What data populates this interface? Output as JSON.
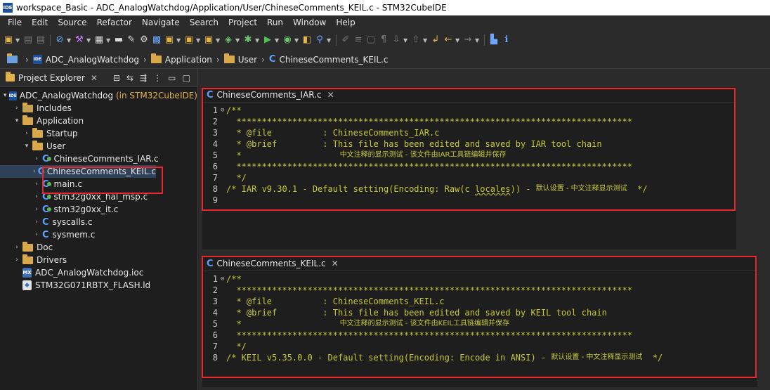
{
  "window": {
    "title": "workspace_Basic - ADC_AnalogWatchdog/Application/User/ChineseComments_KEIL.c - STM32CubeIDE",
    "app_icon_label": "IDE"
  },
  "menu": [
    "File",
    "Edit",
    "Source",
    "Refactor",
    "Navigate",
    "Search",
    "Project",
    "Run",
    "Window",
    "Help"
  ],
  "breadcrumb": [
    "ADC_AnalogWatchdog",
    "Application",
    "User",
    "ChineseComments_KEIL.c"
  ],
  "explorer": {
    "tab_label": "Project Explorer",
    "project": {
      "name": "ADC_AnalogWatchdog",
      "suffix": "(in STM32CubeIDE)"
    },
    "items": [
      {
        "label": "Includes"
      },
      {
        "label": "Application"
      },
      {
        "label": "Startup"
      },
      {
        "label": "User"
      },
      {
        "label": "ChineseComments_IAR.c"
      },
      {
        "label": "ChineseComments_KEIL.c"
      },
      {
        "label": "main.c"
      },
      {
        "label": "stm32g0xx_hal_msp.c"
      },
      {
        "label": "stm32g0xx_it.c"
      },
      {
        "label": "syscalls.c"
      },
      {
        "label": "sysmem.c"
      },
      {
        "label": "Doc"
      },
      {
        "label": "Drivers"
      },
      {
        "label": "ADC_AnalogWatchdog.ioc"
      },
      {
        "label": "STM32G071RBTX_FLASH.ld"
      }
    ]
  },
  "editor_iar": {
    "tab_label": "ChineseComments_IAR.c",
    "lines": [
      {
        "n": "1",
        "text": "/**"
      },
      {
        "n": "2",
        "text": "  ******************************************************************************"
      },
      {
        "n": "3",
        "text": "  * @file          : ChineseComments_IAR.c"
      },
      {
        "n": "4",
        "text": "  * @brief         : This file has been edited and saved by IAR tool chain"
      },
      {
        "n": "5",
        "text": "  *"
      },
      {
        "n": "6",
        "text": "  ******************************************************************************"
      },
      {
        "n": "7",
        "text": "  */"
      },
      {
        "n": "8",
        "text": "/* IAR v9.30.1 - Default setting(Encoding: Raw(c "
      },
      {
        "n": "9",
        "text": ""
      }
    ],
    "line5_cjk": "中文注释的显示测试 - 该文件由IAR工具链编辑并保存",
    "line8_squiggle": "locales",
    "line8_tail": ")) - ",
    "line8_cjk": "默认设置 - 中文注释显示测试",
    "line8_end": "  */"
  },
  "editor_keil": {
    "tab_label": "ChineseComments_KEIL.c",
    "lines": [
      {
        "n": "1",
        "text": "/**"
      },
      {
        "n": "2",
        "text": "  ******************************************************************************"
      },
      {
        "n": "3",
        "text": "  * @file          : ChineseComments_KEIL.c"
      },
      {
        "n": "4",
        "text": "  * @brief         : This file has been edited and saved by KEIL tool chain"
      },
      {
        "n": "5",
        "text": "  *"
      },
      {
        "n": "6",
        "text": "  ******************************************************************************"
      },
      {
        "n": "7",
        "text": "  */"
      },
      {
        "n": "8",
        "text": "/* KEIL v5.35.0.0 - Default setting(Encoding: Encode in ANSI) - "
      }
    ],
    "line5_cjk": "中文注释的显示测试 - 该文件由KEIL工具链编辑并保存",
    "line8_cjk": "默认设置 - 中文注释显示测试",
    "line8_end": "  */"
  }
}
